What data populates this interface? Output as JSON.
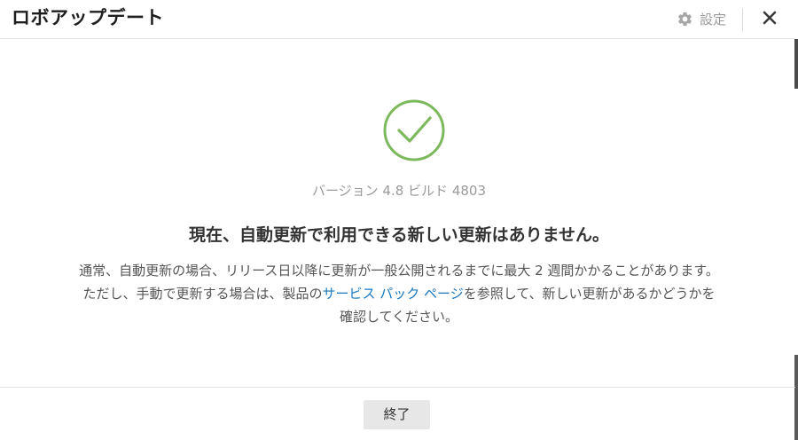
{
  "header": {
    "title": "ロボアップデート",
    "settings_label": "設定",
    "settings_icon": "gear-icon",
    "close_icon": "close-icon"
  },
  "main": {
    "status_icon": "checkmark-circle-icon",
    "check_color": "#7cb85c",
    "version": "バージョン 4.8 ビルド 4803",
    "headline": "現在、自動更新で利用できる新しい更新はありません。",
    "paragraph": {
      "line1": "通常、自動更新の場合、リリース日以降に更新が一般公開されるまでに最大 2 週間かかることがあります。",
      "line2_before": "ただし、手動で更新する場合は、製品の",
      "link_text": "サービス パック ページ",
      "line2_after": "を参照して、新しい更新があるかどうかを",
      "line3": "確認してください。"
    },
    "link_color": "#1a78c2"
  },
  "footer": {
    "close_button_label": "終了"
  }
}
